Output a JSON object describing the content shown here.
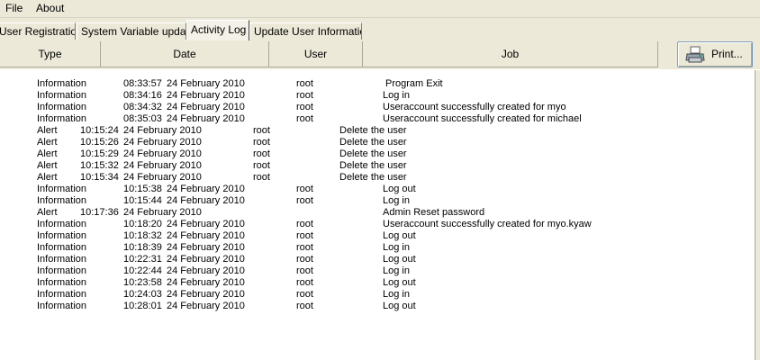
{
  "menu": {
    "file": "File",
    "about": "About"
  },
  "tabs": [
    {
      "label": "User Registration",
      "display": "User Registration"
    },
    {
      "label": "System Variable update"
    },
    {
      "label": "Activity Log"
    },
    {
      "label": "Update User Information"
    }
  ],
  "columns": {
    "type": "Type",
    "date": "Date",
    "user": "User",
    "job": "Job"
  },
  "print_button": {
    "label": "Print...",
    "icon": "printer-icon"
  },
  "colors": {
    "chrome": "#ece9d8",
    "background": "#ffffff"
  },
  "log": [
    {
      "type": "Information",
      "time": "08:33:57",
      "date": "24 February 2010",
      "user": "root",
      "job": "Program Exit"
    },
    {
      "type": "Information",
      "time": "08:34:16",
      "date": "24 February 2010",
      "user": "root",
      "job": "Log in"
    },
    {
      "type": "Information",
      "time": "08:34:32",
      "date": "24 February 2010",
      "user": "root",
      "job": "Useraccount successfully created for myo"
    },
    {
      "type": "Information",
      "time": "08:35:03",
      "date": "24 February 2010",
      "user": "root",
      "job": "Useraccount successfully created for michael"
    },
    {
      "type": "Alert",
      "time": "10:15:24",
      "date": "24 February 2010",
      "user": "root",
      "job": "Delete the user"
    },
    {
      "type": "Alert",
      "time": "10:15:26",
      "date": "24 February 2010",
      "user": "root",
      "job": "Delete the user"
    },
    {
      "type": "Alert",
      "time": "10:15:29",
      "date": "24 February 2010",
      "user": "root",
      "job": "Delete the user"
    },
    {
      "type": "Alert",
      "time": "10:15:32",
      "date": "24 February 2010",
      "user": "root",
      "job": "Delete the user"
    },
    {
      "type": "Alert",
      "time": "10:15:34",
      "date": "24 February 2010",
      "user": "root",
      "job": "Delete the user"
    },
    {
      "type": "Information",
      "time": "10:15:38",
      "date": "24 February 2010",
      "user": "root",
      "job": "Log out"
    },
    {
      "type": "Information",
      "time": "10:15:44",
      "date": "24 February 2010",
      "user": "root",
      "job": "Log in"
    },
    {
      "type": "Alert",
      "time": "10:17:36",
      "date": "24 February 2010",
      "user": "",
      "job": "Admin Reset password"
    },
    {
      "type": "Information",
      "time": "10:18:20",
      "date": "24 February 2010",
      "user": "root",
      "job": "Useraccount successfully created for myo.kyaw"
    },
    {
      "type": "Information",
      "time": "10:18:32",
      "date": "24 February 2010",
      "user": "root",
      "job": "Log out"
    },
    {
      "type": "Information",
      "time": "10:18:39",
      "date": "24 February 2010",
      "user": "root",
      "job": "Log in"
    },
    {
      "type": "Information",
      "time": "10:22:31",
      "date": "24 February 2010",
      "user": "root",
      "job": "Log out"
    },
    {
      "type": "Information",
      "time": "10:22:44",
      "date": "24 February 2010",
      "user": "root",
      "job": "Log in"
    },
    {
      "type": "Information",
      "time": "10:23:58",
      "date": "24 February 2010",
      "user": "root",
      "job": "Log out"
    },
    {
      "type": "Information",
      "time": "10:24:03",
      "date": "24 February 2010",
      "user": "root",
      "job": "Log in"
    },
    {
      "type": "Information",
      "time": "10:28:01",
      "date": "24 February 2010",
      "user": "root",
      "job": "Log out"
    }
  ]
}
